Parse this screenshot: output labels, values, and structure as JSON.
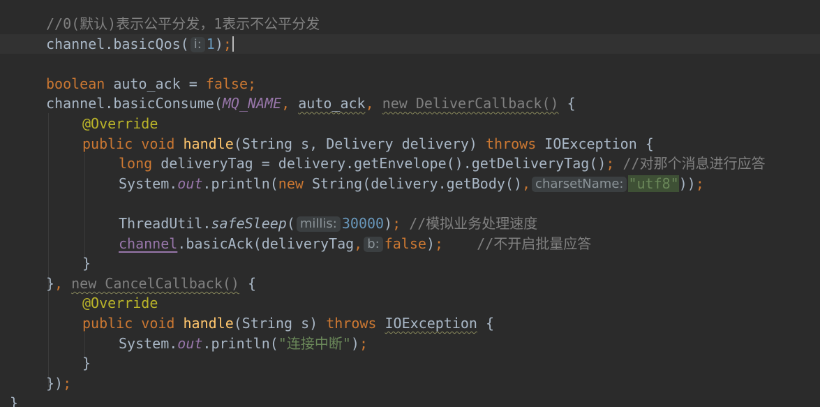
{
  "editor": {
    "colors": {
      "background": "#2b2b2b",
      "current_line": "#323232",
      "keyword": "#cc7832",
      "comment": "#808080",
      "string": "#6a8759",
      "number": "#6897bb",
      "method": "#ffc66d",
      "annotation": "#bbb529",
      "constant": "#9876aa",
      "plain": "#a9b7c6"
    },
    "lines": [
      {
        "tokens": [
          {
            "t": "//0(默认)表示公平分发，1表示不公平分发",
            "c": "comment"
          }
        ]
      },
      {
        "current": true,
        "tokens": [
          {
            "t": "channel.basicQos(",
            "c": "plain"
          },
          {
            "hint": "i:"
          },
          {
            "t": "1",
            "c": "number"
          },
          {
            "t": ")",
            "c": "plain"
          },
          {
            "t": ";",
            "c": "keyword"
          },
          {
            "caret": true
          }
        ]
      },
      {
        "tokens": []
      },
      {
        "tokens": [
          {
            "t": "boolean",
            "c": "keyword"
          },
          {
            "t": " auto_ack = ",
            "c": "plain"
          },
          {
            "t": "false",
            "c": "keyword"
          },
          {
            "t": ";",
            "c": "keyword"
          }
        ]
      },
      {
        "tokens": [
          {
            "t": "channel.basicConsume(",
            "c": "plain"
          },
          {
            "t": "MQ_NAME",
            "c": "constant",
            "s": "italic"
          },
          {
            "t": ", ",
            "c": "keyword"
          },
          {
            "t": "auto_ack",
            "c": "plain",
            "s": "wavy"
          },
          {
            "t": ", ",
            "c": "keyword"
          },
          {
            "t": "new DeliverCallback()",
            "c": "comment",
            "s": "wavy"
          },
          {
            "t": " {",
            "c": "plain"
          }
        ]
      },
      {
        "tokens": [
          {
            "t": "@Override",
            "c": "annotation"
          }
        ]
      },
      {
        "tokens": [
          {
            "t": "public void ",
            "c": "keyword"
          },
          {
            "t": "handle",
            "c": "method"
          },
          {
            "t": "(String s, Delivery delivery) ",
            "c": "plain"
          },
          {
            "t": "throws ",
            "c": "keyword"
          },
          {
            "t": "IOException {",
            "c": "plain"
          }
        ]
      },
      {
        "tokens": [
          {
            "t": "long ",
            "c": "keyword"
          },
          {
            "t": "deliveryTag = delivery.getEnvelope().getDeliveryTag()",
            "c": "plain"
          },
          {
            "t": "; ",
            "c": "keyword"
          },
          {
            "t": "//对那个消息进行应答",
            "c": "comment"
          }
        ]
      },
      {
        "tokens": [
          {
            "t": "System.",
            "c": "plain"
          },
          {
            "t": "out",
            "c": "constant",
            "s": "italic"
          },
          {
            "t": ".println(",
            "c": "plain"
          },
          {
            "t": "new ",
            "c": "keyword"
          },
          {
            "t": "String(delivery.getBody()",
            "c": "plain"
          },
          {
            "t": ",",
            "c": "keyword"
          },
          {
            "hint": "charsetName:"
          },
          {
            "t": "\"utf8\"",
            "c": "string",
            "s": "hl"
          },
          {
            "t": "))",
            "c": "plain"
          },
          {
            "t": ";",
            "c": "keyword"
          }
        ]
      },
      {
        "tokens": []
      },
      {
        "tokens": [
          {
            "t": "ThreadUtil.",
            "c": "plain"
          },
          {
            "t": "safeSleep",
            "c": "plain",
            "s": "italic"
          },
          {
            "t": "(",
            "c": "plain"
          },
          {
            "hint": "millis:"
          },
          {
            "t": "30000",
            "c": "number"
          },
          {
            "t": ")",
            "c": "plain"
          },
          {
            "t": "; ",
            "c": "keyword"
          },
          {
            "t": "//模拟业务处理速度",
            "c": "comment"
          }
        ]
      },
      {
        "tokens": [
          {
            "t": "channel",
            "c": "constant",
            "s": "underline"
          },
          {
            "t": ".basicAck(deliveryTag",
            "c": "plain"
          },
          {
            "t": ",",
            "c": "keyword"
          },
          {
            "hint": "b:"
          },
          {
            "t": "false",
            "c": "keyword"
          },
          {
            "t": ")",
            "c": "plain"
          },
          {
            "t": ";    ",
            "c": "keyword"
          },
          {
            "t": "//不开启批量应答",
            "c": "comment"
          }
        ]
      },
      {
        "tokens": [
          {
            "t": "}",
            "c": "plain"
          }
        ]
      },
      {
        "tokens": [
          {
            "t": "}",
            "c": "plain"
          },
          {
            "t": ", ",
            "c": "keyword"
          },
          {
            "t": "new CancelCallback()",
            "c": "comment",
            "s": "wavy"
          },
          {
            "t": " {",
            "c": "plain"
          }
        ]
      },
      {
        "tokens": [
          {
            "t": "@Override",
            "c": "annotation"
          }
        ]
      },
      {
        "tokens": [
          {
            "t": "public void ",
            "c": "keyword"
          },
          {
            "t": "handle",
            "c": "method"
          },
          {
            "t": "(String s) ",
            "c": "plain"
          },
          {
            "t": "throws ",
            "c": "keyword"
          },
          {
            "t": "IOException",
            "c": "plain",
            "s": "wavy"
          },
          {
            "t": " {",
            "c": "plain"
          }
        ]
      },
      {
        "tokens": [
          {
            "t": "System.",
            "c": "plain"
          },
          {
            "t": "out",
            "c": "constant",
            "s": "italic"
          },
          {
            "t": ".println(",
            "c": "plain"
          },
          {
            "t": "\"连接中断\"",
            "c": "string"
          },
          {
            "t": ")",
            "c": "plain"
          },
          {
            "t": ";",
            "c": "keyword"
          }
        ]
      },
      {
        "tokens": [
          {
            "t": "}",
            "c": "plain"
          }
        ]
      },
      {
        "tokens": [
          {
            "t": "})",
            "c": "plain"
          },
          {
            "t": ";",
            "c": "keyword"
          }
        ]
      },
      {
        "tokens": [
          {
            "t": "}",
            "c": "plain"
          }
        ]
      }
    ]
  }
}
